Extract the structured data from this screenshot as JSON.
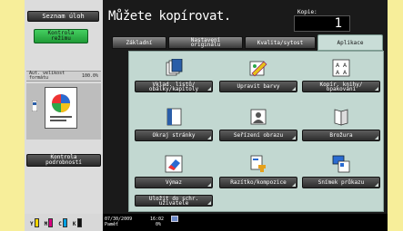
{
  "left": {
    "list_button": "Seznam úloh",
    "check_mode_button": [
      "Kontrola",
      "režimu"
    ],
    "auto_unit": {
      "label": [
        "Aut. velikost",
        "formátu"
      ],
      "value": "100.0%"
    },
    "detail_check_button": [
      "Kontrola",
      "podrobností"
    ],
    "toner": [
      "Y",
      "M",
      "C",
      "K"
    ]
  },
  "header": {
    "title": "Můžete kopírovat.",
    "copies_label": "Kopie:",
    "copies_value": "1"
  },
  "tabs": [
    {
      "label": [
        "Základní"
      ],
      "active": false
    },
    {
      "label": [
        "Nastavení",
        "originálu"
      ],
      "active": false
    },
    {
      "label": [
        "Kvalita/sytost"
      ],
      "active": false
    },
    {
      "label": [
        "Aplikace"
      ],
      "active": true
    }
  ],
  "functions": [
    {
      "label": [
        "Vklad. listů/",
        "obálky/kapitoly"
      ],
      "icon": "sheet-insert-icon"
    },
    {
      "label": [
        "Upravit barvy"
      ],
      "icon": "adjust-color-icon"
    },
    {
      "label": [
        "Kopír. knihy/",
        "opakování"
      ],
      "icon": "book-copy-icon"
    },
    {
      "label": [
        "Okraj stránky"
      ],
      "icon": "page-margin-icon"
    },
    {
      "label": [
        "Seřízení obrazu"
      ],
      "icon": "image-adjust-icon"
    },
    {
      "label": [
        "Brožura"
      ],
      "icon": "booklet-icon"
    },
    {
      "label": [
        "Výmaz"
      ],
      "icon": "erase-icon"
    },
    {
      "label": [
        "Razítko/kompozice"
      ],
      "icon": "stamp-icon"
    },
    {
      "label": [
        "Snímek průkazu"
      ],
      "icon": "id-card-icon"
    },
    {
      "label": [
        "Uložit do schr.",
        "uživatele"
      ],
      "icon": null
    }
  ],
  "status": {
    "date": "07/30/2009",
    "time": "16:02",
    "memory_label": "Paměť",
    "memory_value": "0%"
  },
  "colors": {
    "accent_green": "#2bb448",
    "panel": "#c2d8d1",
    "active_tab": "#c9ddd7"
  }
}
